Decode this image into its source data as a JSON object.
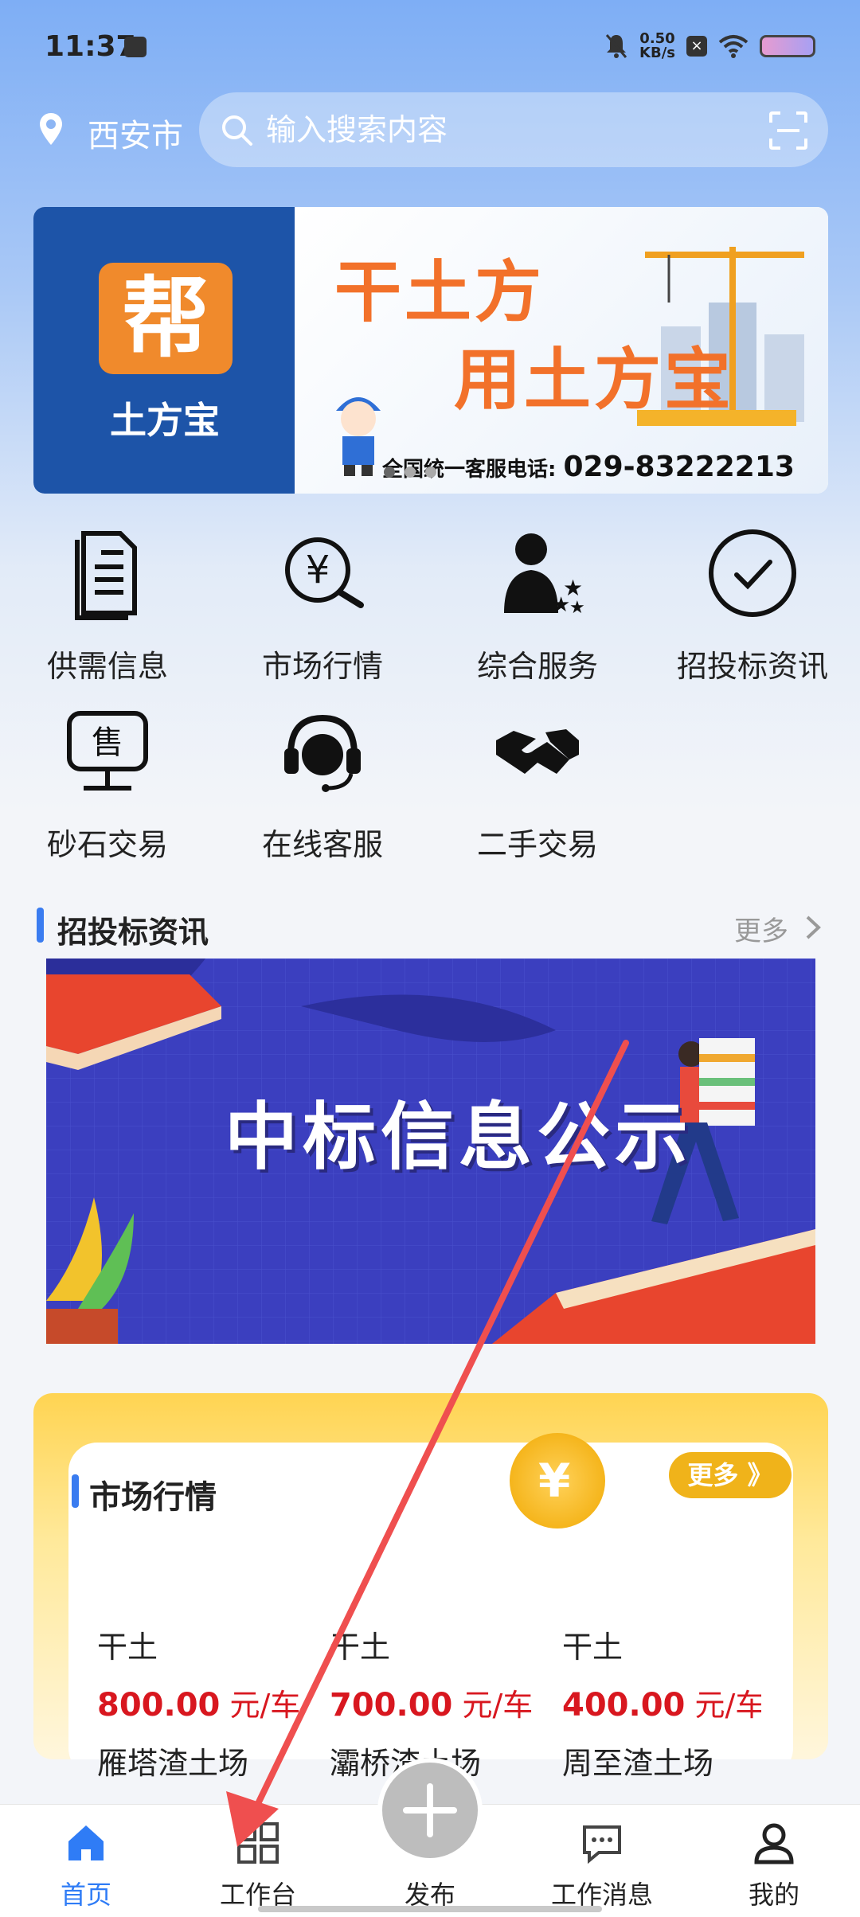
{
  "status_bar": {
    "time": "11:37",
    "net_speed_value": "0.50",
    "net_speed_unit": "KB/s"
  },
  "header": {
    "city": "西安市",
    "search_placeholder": "输入搜索内容"
  },
  "banner": {
    "logo_char": "帮",
    "logo_sub": "土方宝",
    "slogan_line1": "干土方",
    "slogan_line2": "用土方宝",
    "hotline_label": "全国统一客服电话:",
    "hotline_number": "029-83222213"
  },
  "services": [
    {
      "label": "供需信息",
      "icon": "document-icon"
    },
    {
      "label": "市场行情",
      "icon": "yuan-search-icon"
    },
    {
      "label": "综合服务",
      "icon": "person-stars-icon"
    },
    {
      "label": "招投标资讯",
      "icon": "check-circle-icon"
    },
    {
      "label": "砂石交易",
      "icon": "sale-monitor-icon"
    },
    {
      "label": "在线客服",
      "icon": "headset-icon"
    },
    {
      "label": "二手交易",
      "icon": "handshake-icon"
    }
  ],
  "tender_section": {
    "title": "招投标资讯",
    "more": "更多",
    "banner_title": "中标信息公示"
  },
  "market_section": {
    "title": "市场行情",
    "more": "更多 》",
    "items": [
      {
        "type": "干土",
        "price": "800.00",
        "unit": " 元/车",
        "site": "雁塔渣土场"
      },
      {
        "type": "干土",
        "price": "700.00",
        "unit": " 元/车",
        "site": "灞桥渣土场"
      },
      {
        "type": "干土",
        "price": "400.00",
        "unit": " 元/车",
        "site": "周至渣土场"
      }
    ]
  },
  "bottom_nav": {
    "home": "首页",
    "workbench": "工作台",
    "publish": "发布",
    "messages": "工作消息",
    "mine": "我的"
  },
  "colors": {
    "accent_blue": "#2f7cf6",
    "price_red": "#d8171f",
    "brand_orange": "#f2712a"
  }
}
